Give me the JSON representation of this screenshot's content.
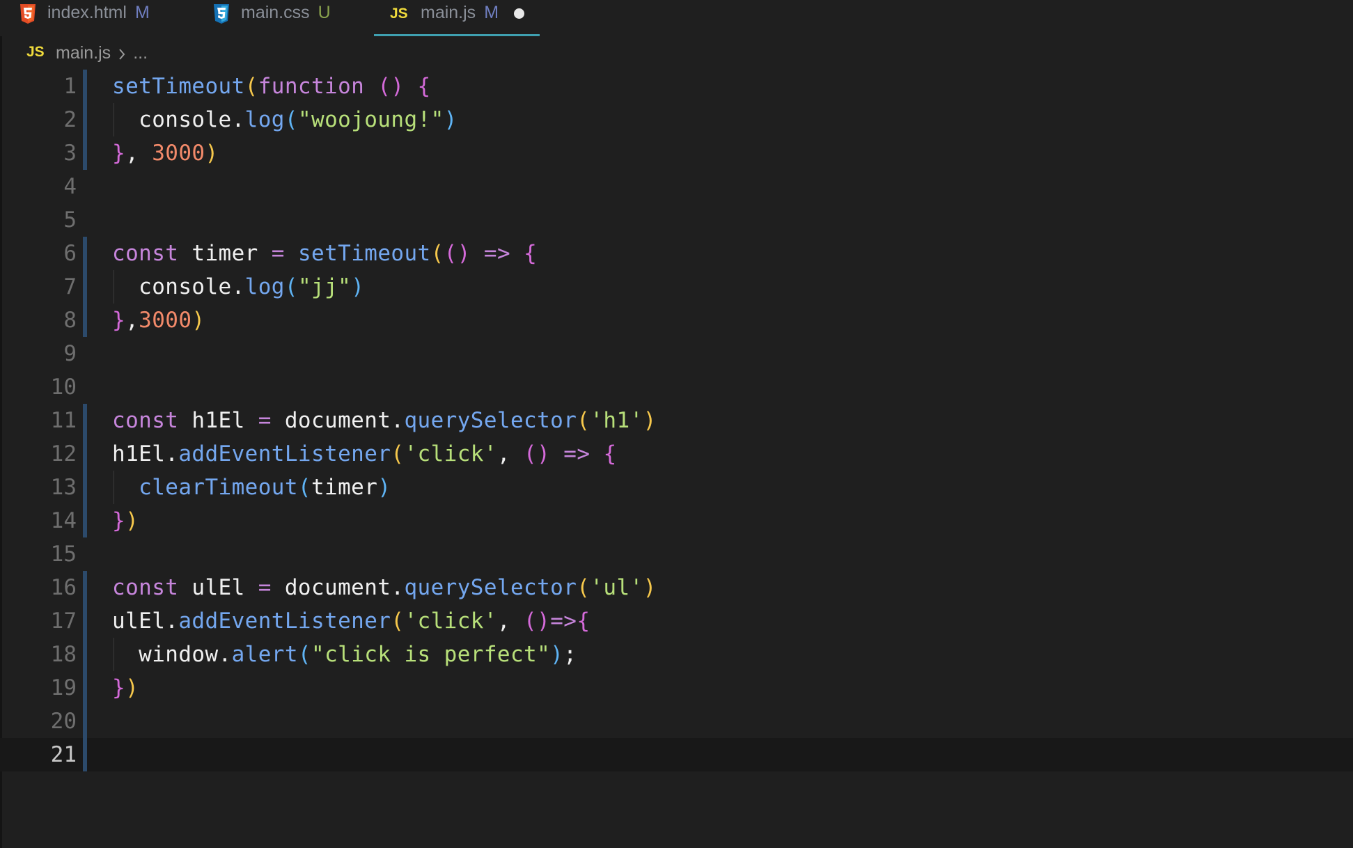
{
  "tabs": [
    {
      "label": "index.html",
      "status": "M",
      "status_color": "#6f7ec0",
      "icon": "html5-icon",
      "active": false
    },
    {
      "label": "main.css",
      "status": "U",
      "status_color": "#8aa34d",
      "icon": "css3-icon",
      "active": false
    },
    {
      "label": "main.js",
      "status": "M",
      "status_color": "#6f7ec0",
      "icon": "javascript-icon",
      "active": true,
      "dirty": true
    }
  ],
  "breadcrumb": {
    "icon_text": "JS",
    "file": "main.js",
    "rest": "..."
  },
  "editor": {
    "active_line": 21,
    "lines": [
      {
        "n": "1",
        "tokens": [
          [
            "setTimeout",
            "fn"
          ],
          [
            "(",
            "br1"
          ],
          [
            "function",
            "kw"
          ],
          [
            " ",
            "pun"
          ],
          [
            "()",
            "br2"
          ],
          [
            " ",
            "pun"
          ],
          [
            "{",
            "br2"
          ]
        ]
      },
      {
        "n": "2",
        "tokens": [
          [
            "  console",
            "var"
          ],
          [
            ".",
            "pun"
          ],
          [
            "log",
            "fn"
          ],
          [
            "(",
            "br3"
          ],
          [
            "\"woojoung!\"",
            "str"
          ],
          [
            ")",
            "br3"
          ]
        ]
      },
      {
        "n": "3",
        "tokens": [
          [
            "}",
            "br2"
          ],
          [
            ", ",
            "pun"
          ],
          [
            "3000",
            "num"
          ],
          [
            ")",
            "br1"
          ]
        ]
      },
      {
        "n": "4",
        "tokens": []
      },
      {
        "n": "5",
        "tokens": []
      },
      {
        "n": "6",
        "tokens": [
          [
            "const",
            "kw"
          ],
          [
            " timer ",
            "var"
          ],
          [
            "=",
            "op"
          ],
          [
            " ",
            "pun"
          ],
          [
            "setTimeout",
            "fn"
          ],
          [
            "(",
            "br1"
          ],
          [
            "()",
            "br2"
          ],
          [
            " ",
            "pun"
          ],
          [
            "=>",
            "op"
          ],
          [
            " ",
            "pun"
          ],
          [
            "{",
            "br2"
          ]
        ]
      },
      {
        "n": "7",
        "tokens": [
          [
            "  console",
            "var"
          ],
          [
            ".",
            "pun"
          ],
          [
            "log",
            "fn"
          ],
          [
            "(",
            "br3"
          ],
          [
            "\"jj\"",
            "str"
          ],
          [
            ")",
            "br3"
          ]
        ]
      },
      {
        "n": "8",
        "tokens": [
          [
            "}",
            "br2"
          ],
          [
            ",",
            "pun"
          ],
          [
            "3000",
            "num"
          ],
          [
            ")",
            "br1"
          ]
        ]
      },
      {
        "n": "9",
        "tokens": []
      },
      {
        "n": "10",
        "tokens": []
      },
      {
        "n": "11",
        "tokens": [
          [
            "const",
            "kw"
          ],
          [
            " h1El ",
            "var"
          ],
          [
            "=",
            "op"
          ],
          [
            " document",
            "var"
          ],
          [
            ".",
            "pun"
          ],
          [
            "querySelector",
            "fn"
          ],
          [
            "(",
            "br1"
          ],
          [
            "'h1'",
            "str"
          ],
          [
            ")",
            "br1"
          ]
        ]
      },
      {
        "n": "12",
        "tokens": [
          [
            "h1El",
            "var"
          ],
          [
            ".",
            "pun"
          ],
          [
            "addEventListener",
            "fn"
          ],
          [
            "(",
            "br1"
          ],
          [
            "'click'",
            "str"
          ],
          [
            ", ",
            "pun"
          ],
          [
            "()",
            "br2"
          ],
          [
            " ",
            "pun"
          ],
          [
            "=>",
            "op"
          ],
          [
            " ",
            "pun"
          ],
          [
            "{",
            "br2"
          ]
        ]
      },
      {
        "n": "13",
        "tokens": [
          [
            "  ",
            "pun"
          ],
          [
            "clearTimeout",
            "fn"
          ],
          [
            "(",
            "br3"
          ],
          [
            "timer",
            "var"
          ],
          [
            ")",
            "br3"
          ]
        ]
      },
      {
        "n": "14",
        "tokens": [
          [
            "}",
            "br2"
          ],
          [
            ")",
            "br1"
          ]
        ]
      },
      {
        "n": "15",
        "tokens": []
      },
      {
        "n": "16",
        "tokens": [
          [
            "const",
            "kw"
          ],
          [
            " ulEl ",
            "var"
          ],
          [
            "=",
            "op"
          ],
          [
            " document",
            "var"
          ],
          [
            ".",
            "pun"
          ],
          [
            "querySelector",
            "fn"
          ],
          [
            "(",
            "br1"
          ],
          [
            "'ul'",
            "str"
          ],
          [
            ")",
            "br1"
          ]
        ]
      },
      {
        "n": "17",
        "tokens": [
          [
            "ulEl",
            "var"
          ],
          [
            ".",
            "pun"
          ],
          [
            "addEventListener",
            "fn"
          ],
          [
            "(",
            "br1"
          ],
          [
            "'click'",
            "str"
          ],
          [
            ", ",
            "pun"
          ],
          [
            "()",
            "br2"
          ],
          [
            "=>",
            "op"
          ],
          [
            "{",
            "br2"
          ]
        ]
      },
      {
        "n": "18",
        "tokens": [
          [
            "  window",
            "var"
          ],
          [
            ".",
            "pun"
          ],
          [
            "alert",
            "fn"
          ],
          [
            "(",
            "br3"
          ],
          [
            "\"click is perfect\"",
            "str"
          ],
          [
            ")",
            "br3"
          ],
          [
            ";",
            "pun"
          ]
        ]
      },
      {
        "n": "19",
        "tokens": [
          [
            "}",
            "br2"
          ],
          [
            ")",
            "br1"
          ]
        ]
      },
      {
        "n": "20",
        "tokens": []
      },
      {
        "n": "21",
        "tokens": []
      }
    ],
    "modified_lines": [
      "1",
      "2",
      "3",
      "6",
      "7",
      "8",
      "11",
      "12",
      "13",
      "14",
      "16",
      "17",
      "18",
      "19",
      "20",
      "21"
    ],
    "indented_lines": [
      "2",
      "7",
      "13",
      "18"
    ]
  },
  "colors": {
    "background": "#1f1f1f",
    "gutter_modified": "#2c4a6b",
    "active_tab_underline": "#3fa0b0",
    "js_icon": "#f1dc3c",
    "html_icon": "#e44d26",
    "css_icon": "#2a8ee0"
  }
}
